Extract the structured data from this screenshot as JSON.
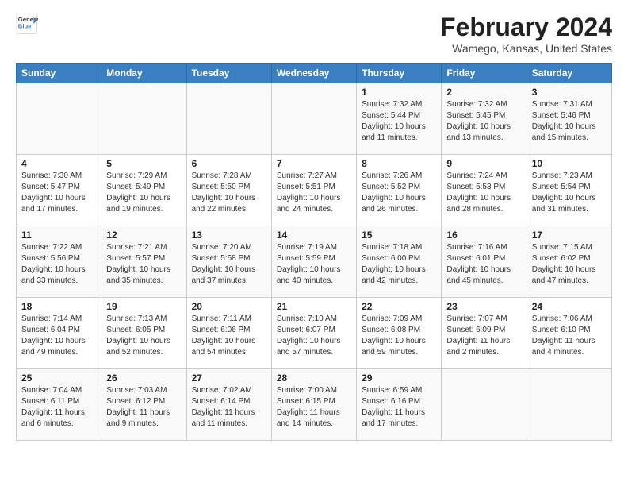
{
  "header": {
    "logo_line1": "General",
    "logo_line2": "Blue",
    "title": "February 2024",
    "subtitle": "Wamego, Kansas, United States"
  },
  "days_of_week": [
    "Sunday",
    "Monday",
    "Tuesday",
    "Wednesday",
    "Thursday",
    "Friday",
    "Saturday"
  ],
  "weeks": [
    [
      {
        "day": "",
        "content": ""
      },
      {
        "day": "",
        "content": ""
      },
      {
        "day": "",
        "content": ""
      },
      {
        "day": "",
        "content": ""
      },
      {
        "day": "1",
        "content": "Sunrise: 7:32 AM\nSunset: 5:44 PM\nDaylight: 10 hours\nand 11 minutes."
      },
      {
        "day": "2",
        "content": "Sunrise: 7:32 AM\nSunset: 5:45 PM\nDaylight: 10 hours\nand 13 minutes."
      },
      {
        "day": "3",
        "content": "Sunrise: 7:31 AM\nSunset: 5:46 PM\nDaylight: 10 hours\nand 15 minutes."
      }
    ],
    [
      {
        "day": "4",
        "content": "Sunrise: 7:30 AM\nSunset: 5:47 PM\nDaylight: 10 hours\nand 17 minutes."
      },
      {
        "day": "5",
        "content": "Sunrise: 7:29 AM\nSunset: 5:49 PM\nDaylight: 10 hours\nand 19 minutes."
      },
      {
        "day": "6",
        "content": "Sunrise: 7:28 AM\nSunset: 5:50 PM\nDaylight: 10 hours\nand 22 minutes."
      },
      {
        "day": "7",
        "content": "Sunrise: 7:27 AM\nSunset: 5:51 PM\nDaylight: 10 hours\nand 24 minutes."
      },
      {
        "day": "8",
        "content": "Sunrise: 7:26 AM\nSunset: 5:52 PM\nDaylight: 10 hours\nand 26 minutes."
      },
      {
        "day": "9",
        "content": "Sunrise: 7:24 AM\nSunset: 5:53 PM\nDaylight: 10 hours\nand 28 minutes."
      },
      {
        "day": "10",
        "content": "Sunrise: 7:23 AM\nSunset: 5:54 PM\nDaylight: 10 hours\nand 31 minutes."
      }
    ],
    [
      {
        "day": "11",
        "content": "Sunrise: 7:22 AM\nSunset: 5:56 PM\nDaylight: 10 hours\nand 33 minutes."
      },
      {
        "day": "12",
        "content": "Sunrise: 7:21 AM\nSunset: 5:57 PM\nDaylight: 10 hours\nand 35 minutes."
      },
      {
        "day": "13",
        "content": "Sunrise: 7:20 AM\nSunset: 5:58 PM\nDaylight: 10 hours\nand 37 minutes."
      },
      {
        "day": "14",
        "content": "Sunrise: 7:19 AM\nSunset: 5:59 PM\nDaylight: 10 hours\nand 40 minutes."
      },
      {
        "day": "15",
        "content": "Sunrise: 7:18 AM\nSunset: 6:00 PM\nDaylight: 10 hours\nand 42 minutes."
      },
      {
        "day": "16",
        "content": "Sunrise: 7:16 AM\nSunset: 6:01 PM\nDaylight: 10 hours\nand 45 minutes."
      },
      {
        "day": "17",
        "content": "Sunrise: 7:15 AM\nSunset: 6:02 PM\nDaylight: 10 hours\nand 47 minutes."
      }
    ],
    [
      {
        "day": "18",
        "content": "Sunrise: 7:14 AM\nSunset: 6:04 PM\nDaylight: 10 hours\nand 49 minutes."
      },
      {
        "day": "19",
        "content": "Sunrise: 7:13 AM\nSunset: 6:05 PM\nDaylight: 10 hours\nand 52 minutes."
      },
      {
        "day": "20",
        "content": "Sunrise: 7:11 AM\nSunset: 6:06 PM\nDaylight: 10 hours\nand 54 minutes."
      },
      {
        "day": "21",
        "content": "Sunrise: 7:10 AM\nSunset: 6:07 PM\nDaylight: 10 hours\nand 57 minutes."
      },
      {
        "day": "22",
        "content": "Sunrise: 7:09 AM\nSunset: 6:08 PM\nDaylight: 10 hours\nand 59 minutes."
      },
      {
        "day": "23",
        "content": "Sunrise: 7:07 AM\nSunset: 6:09 PM\nDaylight: 11 hours\nand 2 minutes."
      },
      {
        "day": "24",
        "content": "Sunrise: 7:06 AM\nSunset: 6:10 PM\nDaylight: 11 hours\nand 4 minutes."
      }
    ],
    [
      {
        "day": "25",
        "content": "Sunrise: 7:04 AM\nSunset: 6:11 PM\nDaylight: 11 hours\nand 6 minutes."
      },
      {
        "day": "26",
        "content": "Sunrise: 7:03 AM\nSunset: 6:12 PM\nDaylight: 11 hours\nand 9 minutes."
      },
      {
        "day": "27",
        "content": "Sunrise: 7:02 AM\nSunset: 6:14 PM\nDaylight: 11 hours\nand 11 minutes."
      },
      {
        "day": "28",
        "content": "Sunrise: 7:00 AM\nSunset: 6:15 PM\nDaylight: 11 hours\nand 14 minutes."
      },
      {
        "day": "29",
        "content": "Sunrise: 6:59 AM\nSunset: 6:16 PM\nDaylight: 11 hours\nand 17 minutes."
      },
      {
        "day": "",
        "content": ""
      },
      {
        "day": "",
        "content": ""
      }
    ]
  ]
}
